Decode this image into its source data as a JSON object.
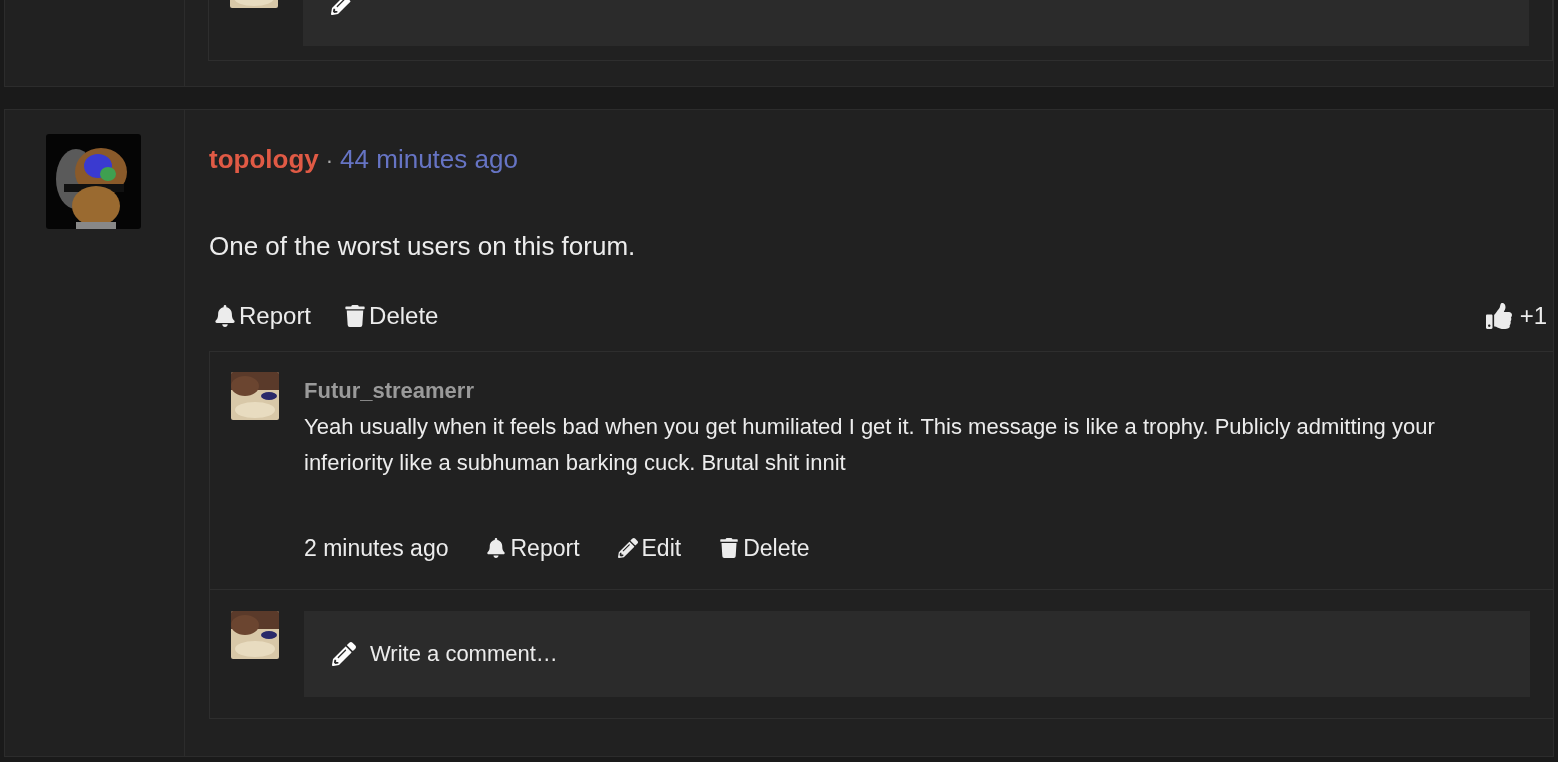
{
  "post": {
    "author": "topology",
    "separator": "·",
    "time": "44 minutes ago",
    "body": "One of the worst users on this forum.",
    "actions": [
      {
        "kind": "report",
        "label": "Report"
      },
      {
        "kind": "delete",
        "label": "Delete"
      }
    ],
    "likes": "+1",
    "replies": [
      {
        "author": "Futur_streamerr",
        "body": "Yeah usually when it feels bad when you get humiliated I get it. This message is like a trophy. Publicly admitting your inferiority like a subhuman barking cuck. Brutal shit innit",
        "time": "2 minutes ago",
        "actions": [
          {
            "kind": "report",
            "label": "Report"
          },
          {
            "kind": "edit",
            "label": "Edit"
          },
          {
            "kind": "delete",
            "label": "Delete"
          }
        ]
      }
    ],
    "comment_box": {
      "placeholder": "Write a comment…"
    }
  }
}
